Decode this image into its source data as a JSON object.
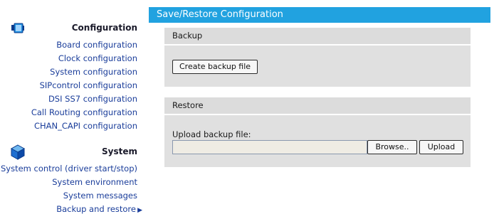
{
  "sidebar": {
    "configuration": {
      "title": "Configuration",
      "icon": "window-icon",
      "items": [
        {
          "label": "Board configuration"
        },
        {
          "label": "Clock configuration"
        },
        {
          "label": "System configuration"
        },
        {
          "label": "SIPcontrol configuration"
        },
        {
          "label": "DSI SS7 configuration"
        },
        {
          "label": "Call Routing configuration"
        },
        {
          "label": "CHAN_CAPI configuration"
        }
      ]
    },
    "system": {
      "title": "System",
      "icon": "cube-icon",
      "items": [
        {
          "label": "System control (driver start/stop)"
        },
        {
          "label": "System environment"
        },
        {
          "label": "System messages"
        },
        {
          "label": "Backup and restore"
        }
      ]
    }
  },
  "main": {
    "title": "Save/Restore Configuration",
    "backup": {
      "heading": "Backup",
      "create_button": "Create backup file"
    },
    "restore": {
      "heading": "Restore",
      "upload_label": "Upload backup file:",
      "file_value": "",
      "browse_button": "Browse..",
      "upload_button": "Upload"
    }
  },
  "colors": {
    "title_bar": "#21a2e0",
    "panel_bg": "#e0e0e0",
    "link": "#1a3d9a"
  }
}
